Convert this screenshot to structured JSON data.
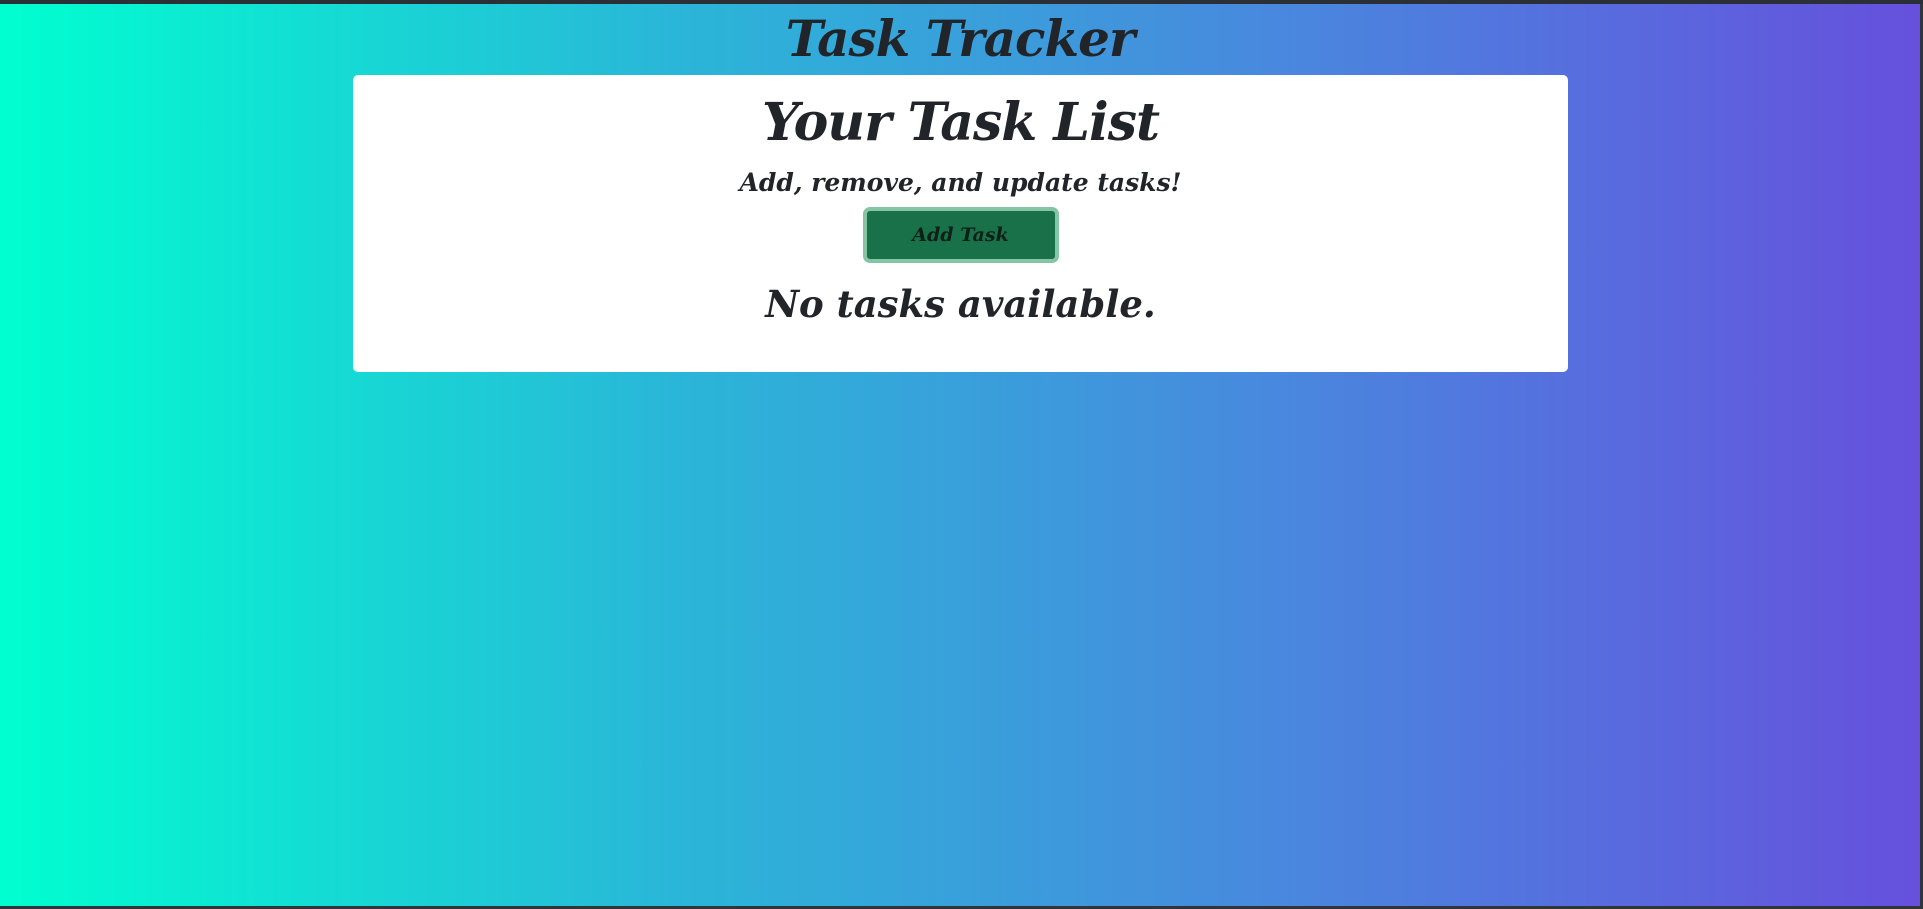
{
  "app": {
    "title": "Task Tracker"
  },
  "card": {
    "title": "Your Task List",
    "subtitle": "Add, remove, and update tasks!",
    "add_button_label": "Add Task",
    "empty_message": "No tasks available."
  },
  "colors": {
    "gradient_start": "#00ffd0",
    "gradient_end": "#6650dd",
    "button_bg": "#187149",
    "button_border": "#86c5a4",
    "text": "#212529"
  }
}
